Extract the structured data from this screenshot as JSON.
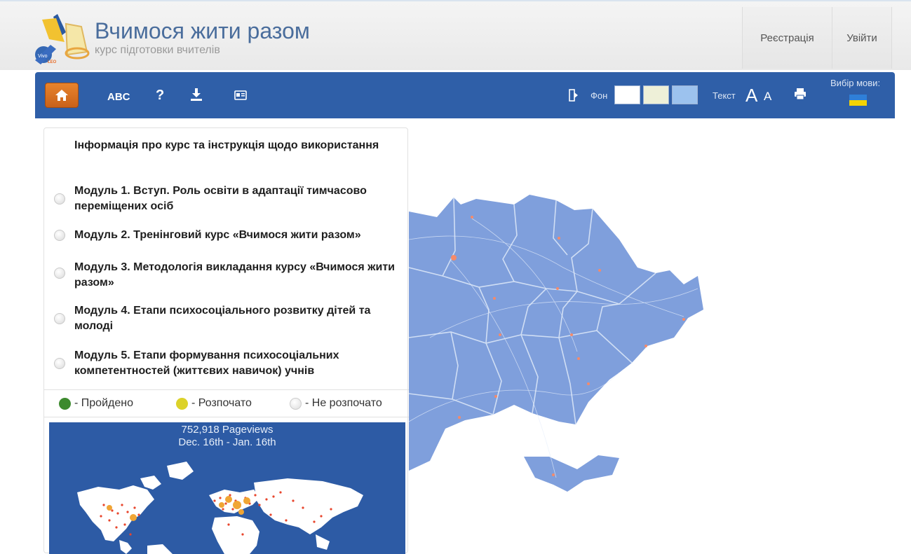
{
  "header": {
    "title": "Вчимося жити разом",
    "subtitle": "курс підготовки вчителів",
    "register_label": "Реєстрація",
    "login_label": "Увійти"
  },
  "toolbar": {
    "abc_label": "ABC",
    "help_label": "?",
    "background_label": "Фон",
    "background_swatches": [
      "#ffffff",
      "#eef0d8",
      "#9cc2ee"
    ],
    "text_label": "Текст",
    "text_large_label": "A",
    "text_small_label": "A",
    "language_label": "Вибір мови:",
    "accent_color": "#2f5fa8",
    "home_color": "#d66f22"
  },
  "modules": [
    {
      "label": "Інформація про курс та інструкція щодо використання",
      "status": "none"
    },
    {
      "label": "Модуль 1. Вступ. Роль освіти в адаптації тимчасово переміщених осіб",
      "status": "not-started"
    },
    {
      "label": "Модуль 2. Тренінговий курс «Вчимося жити разом»",
      "status": "not-started"
    },
    {
      "label": "Модуль 3. Методологія викладання курсу «Вчимося жити разом»",
      "status": "not-started"
    },
    {
      "label": "Модуль 4. Етапи психосоціального розвитку дітей та молоді",
      "status": "not-started"
    },
    {
      "label": "Модуль 5. Етапи формування психосоціальних компетентностей (життєвих навичок) учнів",
      "status": "not-started"
    }
  ],
  "legend": {
    "completed": "- Пройдено",
    "started": "- Розпочато",
    "not_started": "- Не розпочато",
    "completed_color": "#3d8a2e",
    "started_color": "#dcd22a"
  },
  "pageviews": {
    "count": "752,918 Pageviews",
    "period": "Dec. 16th - Jan. 16th"
  }
}
